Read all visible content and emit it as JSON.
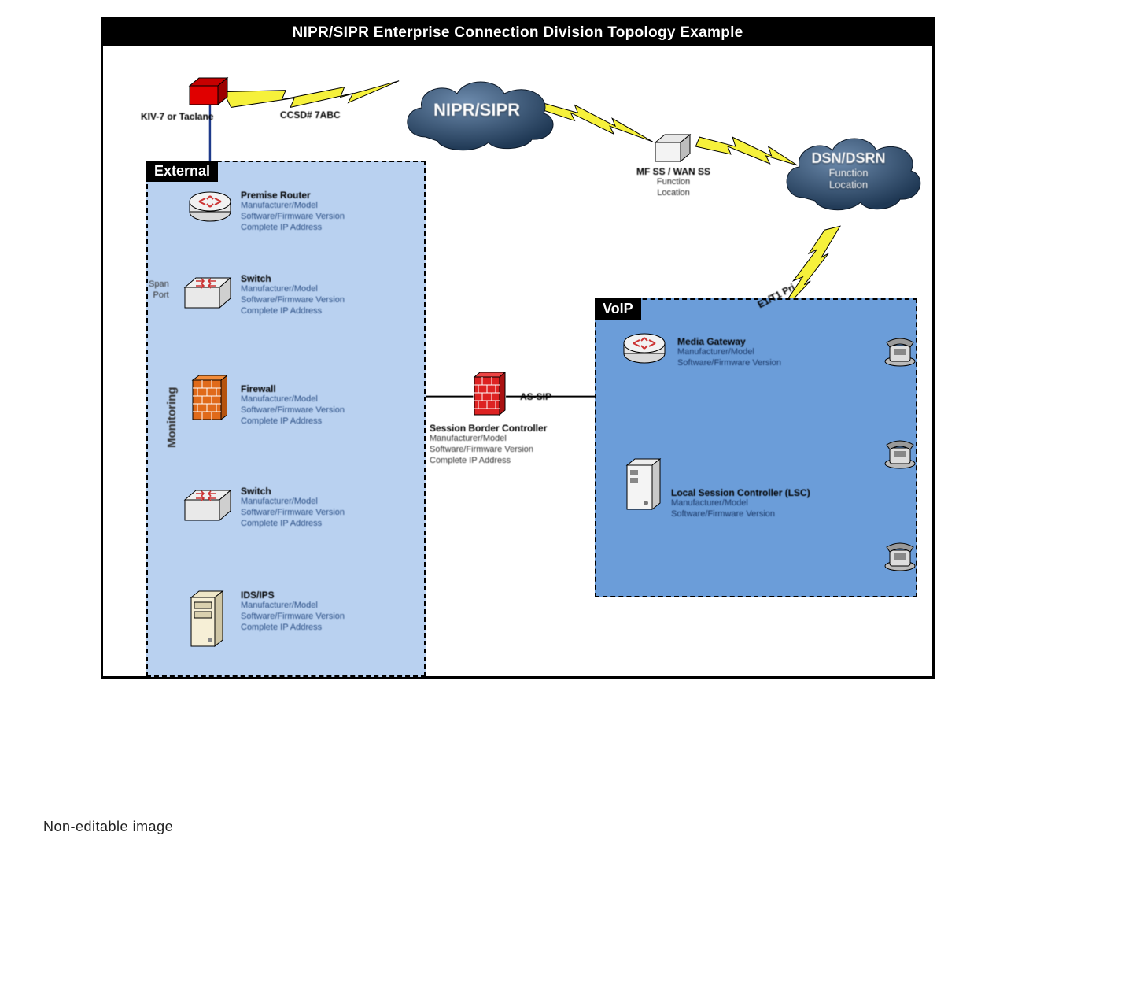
{
  "title": "NIPR/SIPR Enterprise Connection Division Topology Example",
  "footer": "Non-editable image",
  "clouds": {
    "nipr": {
      "label": "NIPR/SIPR"
    },
    "dsn": {
      "label": "DSN/DSRN",
      "sub1": "Function",
      "sub2": "Location"
    }
  },
  "zones": {
    "external": "External",
    "voip": "VoIP",
    "monitoring": "Monitoring"
  },
  "links": {
    "ccsd": "CCSD# 7ABC",
    "kiv": "KIV-7 or Taclane",
    "assip": "AS-SIP",
    "e1t1": "E1/T1 Pri",
    "spanport": "Span\nPort"
  },
  "nodes": {
    "mfss": {
      "title": "MF SS / WAN SS",
      "l1": "Function",
      "l2": "Location"
    },
    "premise_router": {
      "title": "Premise Router",
      "l1": "Manufacturer/Model",
      "l2": "Software/Firmware Version",
      "l3": "Complete IP Address"
    },
    "switch1": {
      "title": "Switch",
      "l1": "Manufacturer/Model",
      "l2": "Software/Firmware Version",
      "l3": "Complete IP Address"
    },
    "firewall": {
      "title": "Firewall",
      "l1": "Manufacturer/Model",
      "l2": "Software/Firmware Version",
      "l3": "Complete IP Address"
    },
    "switch2": {
      "title": "Switch",
      "l1": "Manufacturer/Model",
      "l2": "Software/Firmware Version",
      "l3": "Complete IP Address"
    },
    "ids": {
      "title": "IDS/IPS",
      "l1": "Manufacturer/Model",
      "l2": "Software/Firmware Version",
      "l3": "Complete IP Address"
    },
    "sbc": {
      "title": "Session Border Controller",
      "l1": "Manufacturer/Model",
      "l2": "Software/Firmware Version",
      "l3": "Complete IP Address"
    },
    "media_gw": {
      "title": "Media Gateway",
      "l1": "Manufacturer/Model",
      "l2": "Software/Firmware Version"
    },
    "lsc": {
      "title": "Local Session Controller (LSC)",
      "l1": "Manufacturer/Model",
      "l2": "Software/Firmware Version"
    }
  }
}
